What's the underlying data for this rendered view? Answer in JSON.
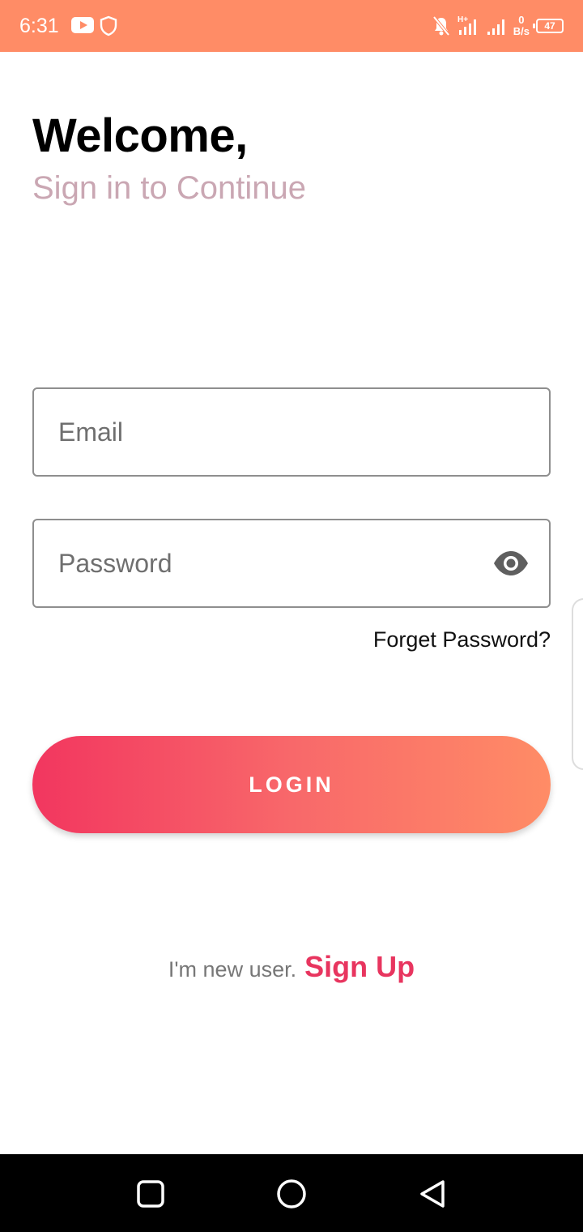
{
  "status_bar": {
    "time": "6:31",
    "net_speed_value": "0",
    "net_speed_unit": "B/s",
    "battery": "47",
    "icons": [
      "youtube-icon",
      "shield-icon",
      "mute-bell-icon",
      "signal-h-plus-icon",
      "signal-icon",
      "battery-icon"
    ]
  },
  "login": {
    "title": "Welcome,",
    "subtitle": "Sign in to Continue",
    "email_placeholder": "Email",
    "password_placeholder": "Password",
    "forgot_label": "Forget Password?",
    "login_label": "LOGIN",
    "new_user_text": "I'm new user.",
    "signup_label": "Sign Up"
  },
  "nav_bar": {
    "buttons": [
      "recent-apps-icon",
      "home-icon",
      "back-icon"
    ]
  },
  "colors": {
    "status_bar": "#ff8c66",
    "accent": "#e8355f",
    "gradient_start": "#f2365f",
    "gradient_end": "#ff8c66",
    "subtitle": "#caa7b3"
  }
}
